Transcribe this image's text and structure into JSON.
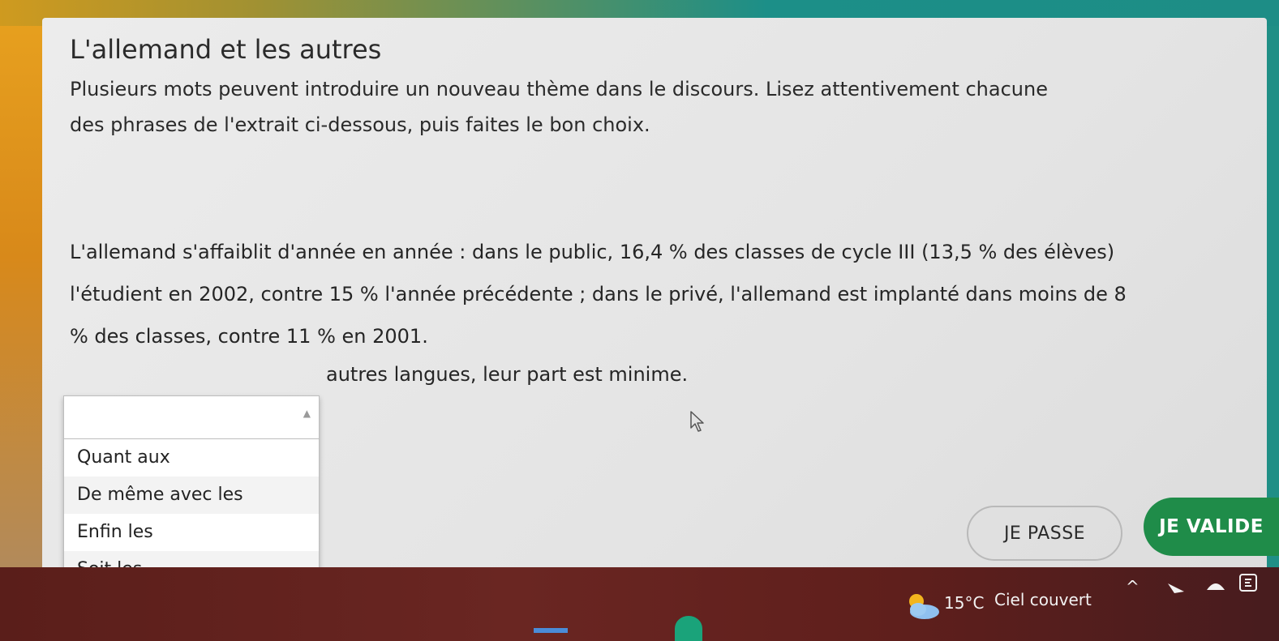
{
  "exercise": {
    "title": "L'allemand et les autres",
    "instructions": [
      "Plusieurs mots peuvent introduire un nouveau thème dans le discours. Lisez attentivement chacune",
      "des phrases de l'extrait ci-dessous, puis faites le bon choix."
    ],
    "passage": [
      "L'allemand s'affaiblit d'année en année : dans le public, 16,4 % des classes de cycle III (13,5 % des élèves)",
      "l'étudient en 2002, contre 15 % l'année précédente ; dans le privé, l'allemand est implanté dans moins de 8",
      "% des classes, contre 11 % en 2001."
    ],
    "sentence_after_blank": "autres langues, leur part est minime.",
    "dropdown": {
      "selected": "",
      "options": [
        "Quant aux",
        "De même avec les",
        "Enfin les",
        "Soit les"
      ]
    },
    "buttons": {
      "skip": "JE PASSE",
      "validate": "JE VALIDE"
    }
  },
  "taskbar": {
    "weather_temp": "15°C",
    "weather_desc": "Ciel couvert"
  },
  "colors": {
    "validate_button": "#1f8c49",
    "taskbar": "#5f1f1c",
    "card": "#e6e6e6"
  }
}
